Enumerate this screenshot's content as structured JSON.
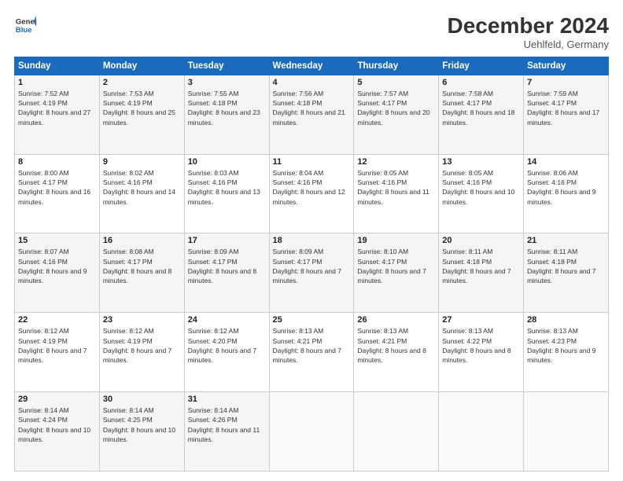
{
  "header": {
    "logo_line1": "General",
    "logo_line2": "Blue",
    "month_title": "December 2024",
    "location": "Uehlfeld, Germany"
  },
  "weekdays": [
    "Sunday",
    "Monday",
    "Tuesday",
    "Wednesday",
    "Thursday",
    "Friday",
    "Saturday"
  ],
  "weeks": [
    [
      {
        "day": "1",
        "sunrise": "Sunrise: 7:52 AM",
        "sunset": "Sunset: 4:19 PM",
        "daylight": "Daylight: 8 hours and 27 minutes."
      },
      {
        "day": "2",
        "sunrise": "Sunrise: 7:53 AM",
        "sunset": "Sunset: 4:19 PM",
        "daylight": "Daylight: 8 hours and 25 minutes."
      },
      {
        "day": "3",
        "sunrise": "Sunrise: 7:55 AM",
        "sunset": "Sunset: 4:18 PM",
        "daylight": "Daylight: 8 hours and 23 minutes."
      },
      {
        "day": "4",
        "sunrise": "Sunrise: 7:56 AM",
        "sunset": "Sunset: 4:18 PM",
        "daylight": "Daylight: 8 hours and 21 minutes."
      },
      {
        "day": "5",
        "sunrise": "Sunrise: 7:57 AM",
        "sunset": "Sunset: 4:17 PM",
        "daylight": "Daylight: 8 hours and 20 minutes."
      },
      {
        "day": "6",
        "sunrise": "Sunrise: 7:58 AM",
        "sunset": "Sunset: 4:17 PM",
        "daylight": "Daylight: 8 hours and 18 minutes."
      },
      {
        "day": "7",
        "sunrise": "Sunrise: 7:59 AM",
        "sunset": "Sunset: 4:17 PM",
        "daylight": "Daylight: 8 hours and 17 minutes."
      }
    ],
    [
      {
        "day": "8",
        "sunrise": "Sunrise: 8:00 AM",
        "sunset": "Sunset: 4:17 PM",
        "daylight": "Daylight: 8 hours and 16 minutes."
      },
      {
        "day": "9",
        "sunrise": "Sunrise: 8:02 AM",
        "sunset": "Sunset: 4:16 PM",
        "daylight": "Daylight: 8 hours and 14 minutes."
      },
      {
        "day": "10",
        "sunrise": "Sunrise: 8:03 AM",
        "sunset": "Sunset: 4:16 PM",
        "daylight": "Daylight: 8 hours and 13 minutes."
      },
      {
        "day": "11",
        "sunrise": "Sunrise: 8:04 AM",
        "sunset": "Sunset: 4:16 PM",
        "daylight": "Daylight: 8 hours and 12 minutes."
      },
      {
        "day": "12",
        "sunrise": "Sunrise: 8:05 AM",
        "sunset": "Sunset: 4:16 PM",
        "daylight": "Daylight: 8 hours and 11 minutes."
      },
      {
        "day": "13",
        "sunrise": "Sunrise: 8:05 AM",
        "sunset": "Sunset: 4:16 PM",
        "daylight": "Daylight: 8 hours and 10 minutes."
      },
      {
        "day": "14",
        "sunrise": "Sunrise: 8:06 AM",
        "sunset": "Sunset: 4:16 PM",
        "daylight": "Daylight: 8 hours and 9 minutes."
      }
    ],
    [
      {
        "day": "15",
        "sunrise": "Sunrise: 8:07 AM",
        "sunset": "Sunset: 4:16 PM",
        "daylight": "Daylight: 8 hours and 9 minutes."
      },
      {
        "day": "16",
        "sunrise": "Sunrise: 8:08 AM",
        "sunset": "Sunset: 4:17 PM",
        "daylight": "Daylight: 8 hours and 8 minutes."
      },
      {
        "day": "17",
        "sunrise": "Sunrise: 8:09 AM",
        "sunset": "Sunset: 4:17 PM",
        "daylight": "Daylight: 8 hours and 8 minutes."
      },
      {
        "day": "18",
        "sunrise": "Sunrise: 8:09 AM",
        "sunset": "Sunset: 4:17 PM",
        "daylight": "Daylight: 8 hours and 7 minutes."
      },
      {
        "day": "19",
        "sunrise": "Sunrise: 8:10 AM",
        "sunset": "Sunset: 4:17 PM",
        "daylight": "Daylight: 8 hours and 7 minutes."
      },
      {
        "day": "20",
        "sunrise": "Sunrise: 8:11 AM",
        "sunset": "Sunset: 4:18 PM",
        "daylight": "Daylight: 8 hours and 7 minutes."
      },
      {
        "day": "21",
        "sunrise": "Sunrise: 8:11 AM",
        "sunset": "Sunset: 4:18 PM",
        "daylight": "Daylight: 8 hours and 7 minutes."
      }
    ],
    [
      {
        "day": "22",
        "sunrise": "Sunrise: 8:12 AM",
        "sunset": "Sunset: 4:19 PM",
        "daylight": "Daylight: 8 hours and 7 minutes."
      },
      {
        "day": "23",
        "sunrise": "Sunrise: 8:12 AM",
        "sunset": "Sunset: 4:19 PM",
        "daylight": "Daylight: 8 hours and 7 minutes."
      },
      {
        "day": "24",
        "sunrise": "Sunrise: 8:12 AM",
        "sunset": "Sunset: 4:20 PM",
        "daylight": "Daylight: 8 hours and 7 minutes."
      },
      {
        "day": "25",
        "sunrise": "Sunrise: 8:13 AM",
        "sunset": "Sunset: 4:21 PM",
        "daylight": "Daylight: 8 hours and 7 minutes."
      },
      {
        "day": "26",
        "sunrise": "Sunrise: 8:13 AM",
        "sunset": "Sunset: 4:21 PM",
        "daylight": "Daylight: 8 hours and 8 minutes."
      },
      {
        "day": "27",
        "sunrise": "Sunrise: 8:13 AM",
        "sunset": "Sunset: 4:22 PM",
        "daylight": "Daylight: 8 hours and 8 minutes."
      },
      {
        "day": "28",
        "sunrise": "Sunrise: 8:13 AM",
        "sunset": "Sunset: 4:23 PM",
        "daylight": "Daylight: 8 hours and 9 minutes."
      }
    ],
    [
      {
        "day": "29",
        "sunrise": "Sunrise: 8:14 AM",
        "sunset": "Sunset: 4:24 PM",
        "daylight": "Daylight: 8 hours and 10 minutes."
      },
      {
        "day": "30",
        "sunrise": "Sunrise: 8:14 AM",
        "sunset": "Sunset: 4:25 PM",
        "daylight": "Daylight: 8 hours and 10 minutes."
      },
      {
        "day": "31",
        "sunrise": "Sunrise: 8:14 AM",
        "sunset": "Sunset: 4:26 PM",
        "daylight": "Daylight: 8 hours and 11 minutes."
      },
      null,
      null,
      null,
      null
    ]
  ]
}
